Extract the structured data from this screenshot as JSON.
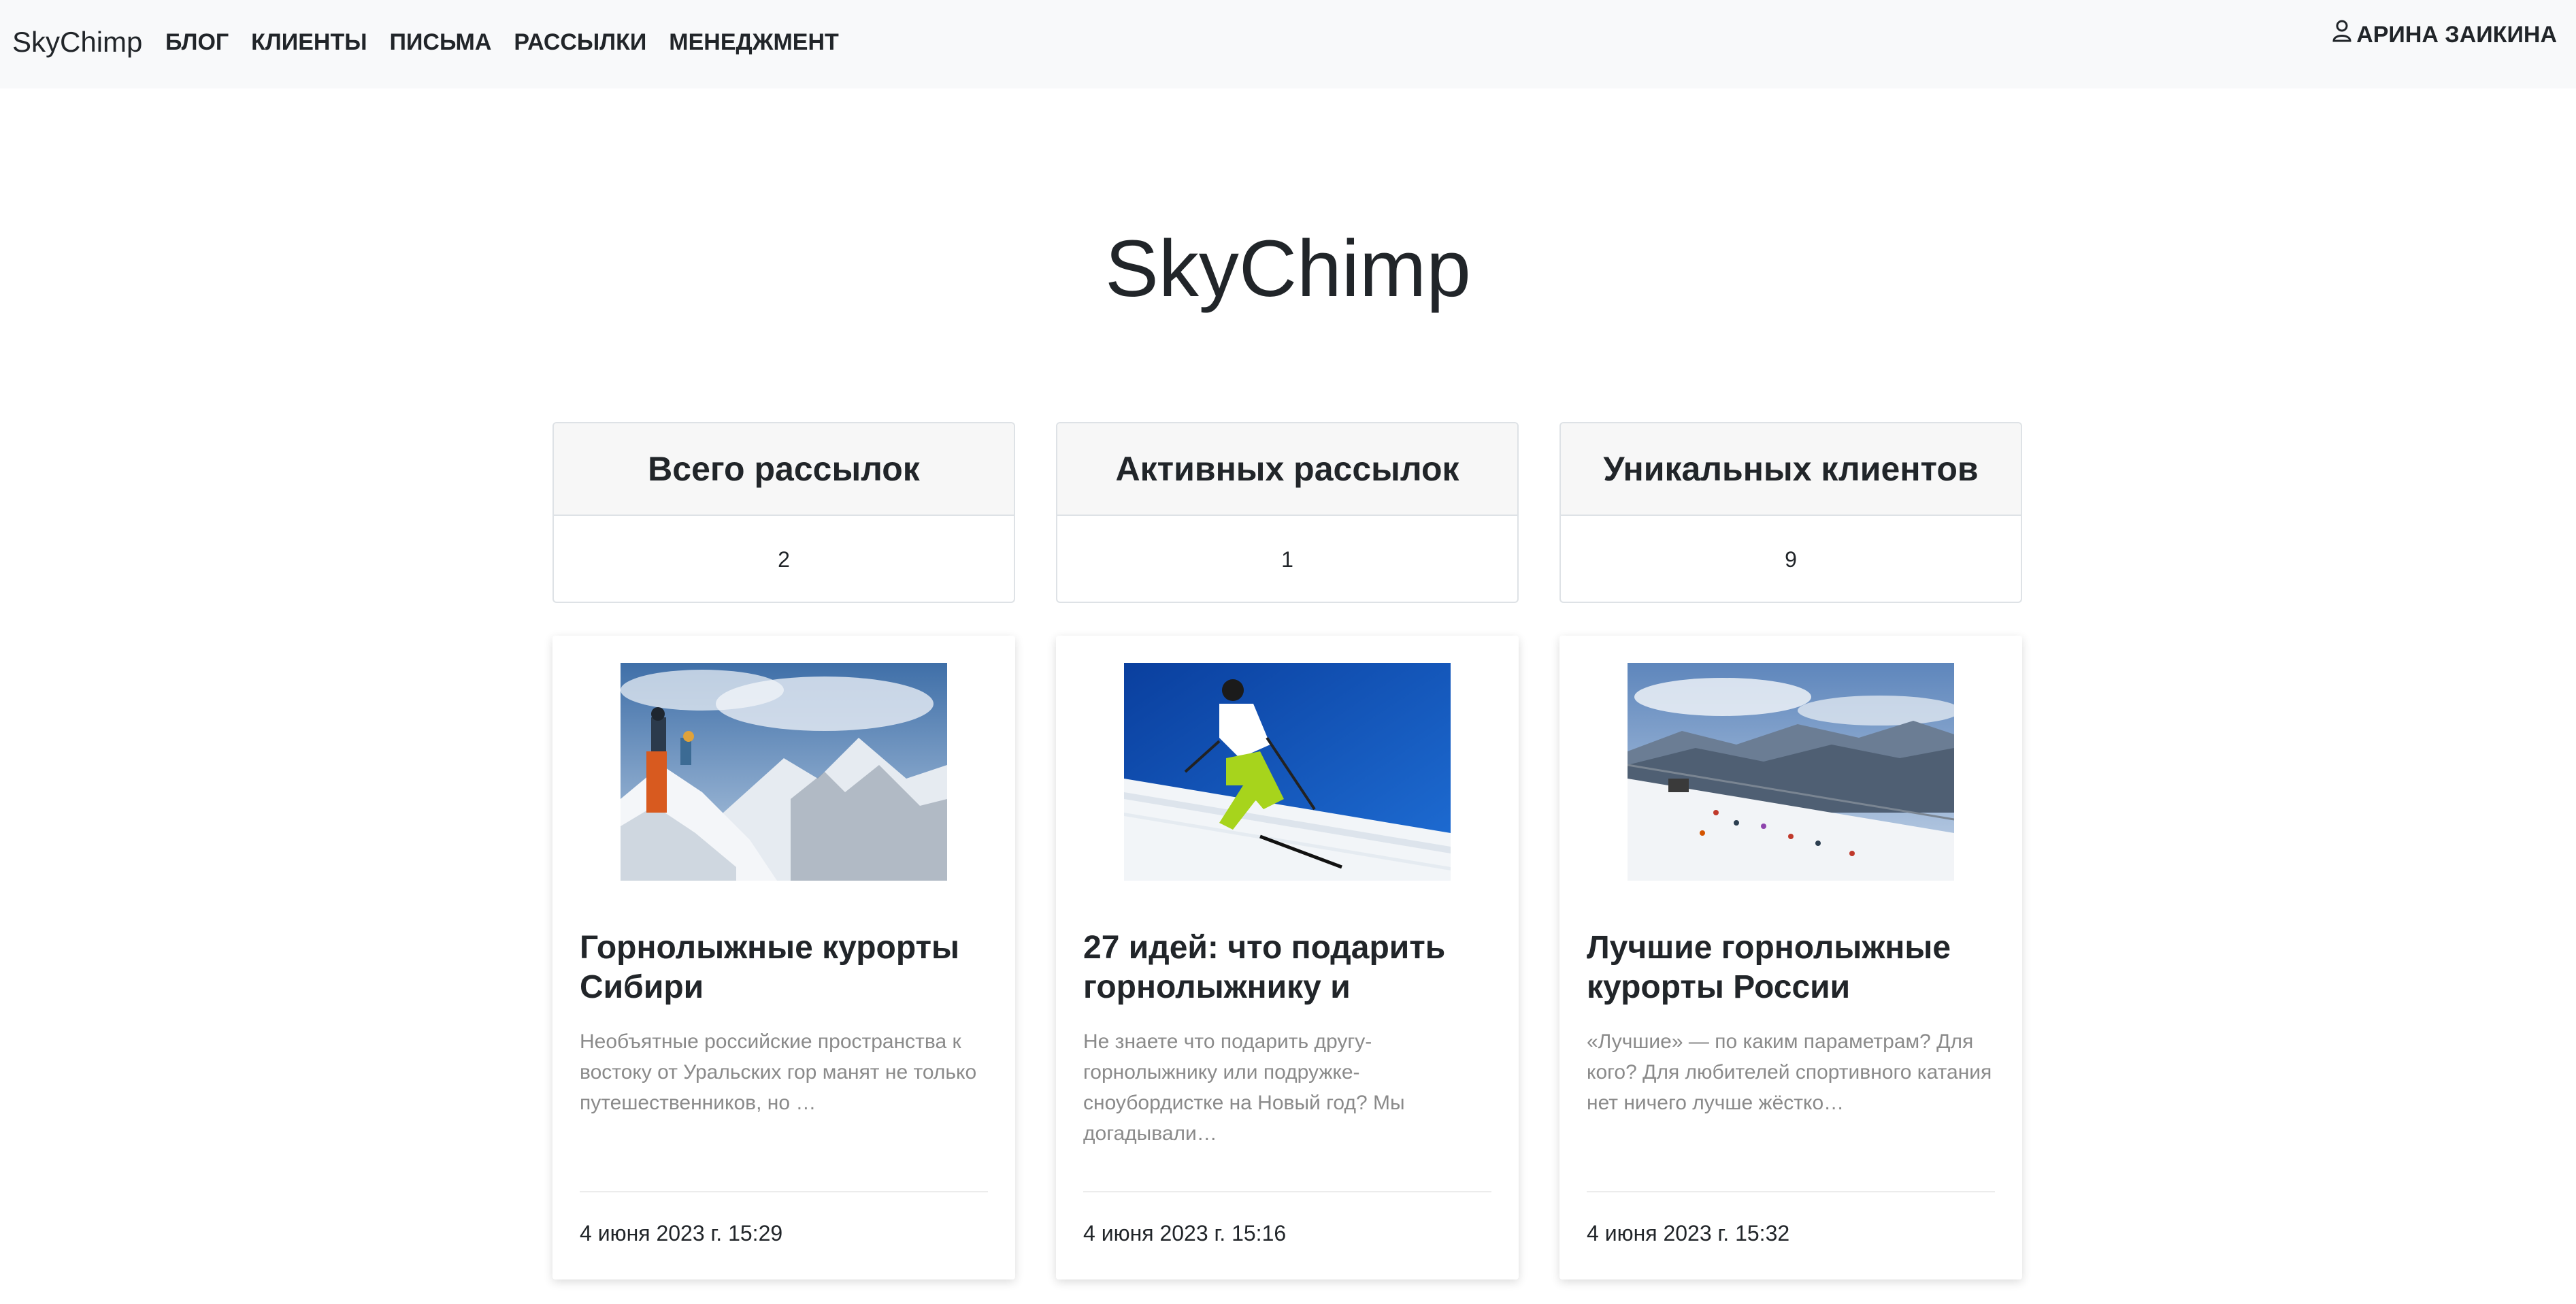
{
  "navbar": {
    "brand": "SkyChimp",
    "links": [
      "БЛОГ",
      "КЛИЕНТЫ",
      "ПИСЬМА",
      "РАССЫЛКИ",
      "МЕНЕДЖМЕНТ"
    ],
    "user_name": "АРИНА ЗАИКИНА",
    "user_icon": "person-icon"
  },
  "hero": {
    "title": "SkyChimp"
  },
  "stats": [
    {
      "label": "Всего рассылок",
      "value": "2"
    },
    {
      "label": "Активных рассылок",
      "value": "1"
    },
    {
      "label": "Уникальных клиентов",
      "value": "9"
    }
  ],
  "posts": [
    {
      "title": "Горнолыжные курорты Сибири",
      "text": "Необъятные российские пространства к востоку от Уральских гор манят не только путешественников, но …",
      "date": "4 июня 2023 г. 15:29",
      "image": "mountain-climbers-photo"
    },
    {
      "title": "27 идей: что подарить горнолыжнику и",
      "text": "Не знаете что подарить другу-горнолыжнику или подружке-сноубордистке на Новый год? Мы догадывали…",
      "date": "4 июня 2023 г. 15:16",
      "image": "skier-photo"
    },
    {
      "title": "Лучшие горнолыжные курорты России",
      "text": "«Лучшие» — по каким параметрам? Для кого? Для любителей спортивного катания нет ничего лучше жёстко…",
      "date": "4 июня 2023 г. 15:32",
      "image": "ski-resort-slope-photo"
    }
  ]
}
